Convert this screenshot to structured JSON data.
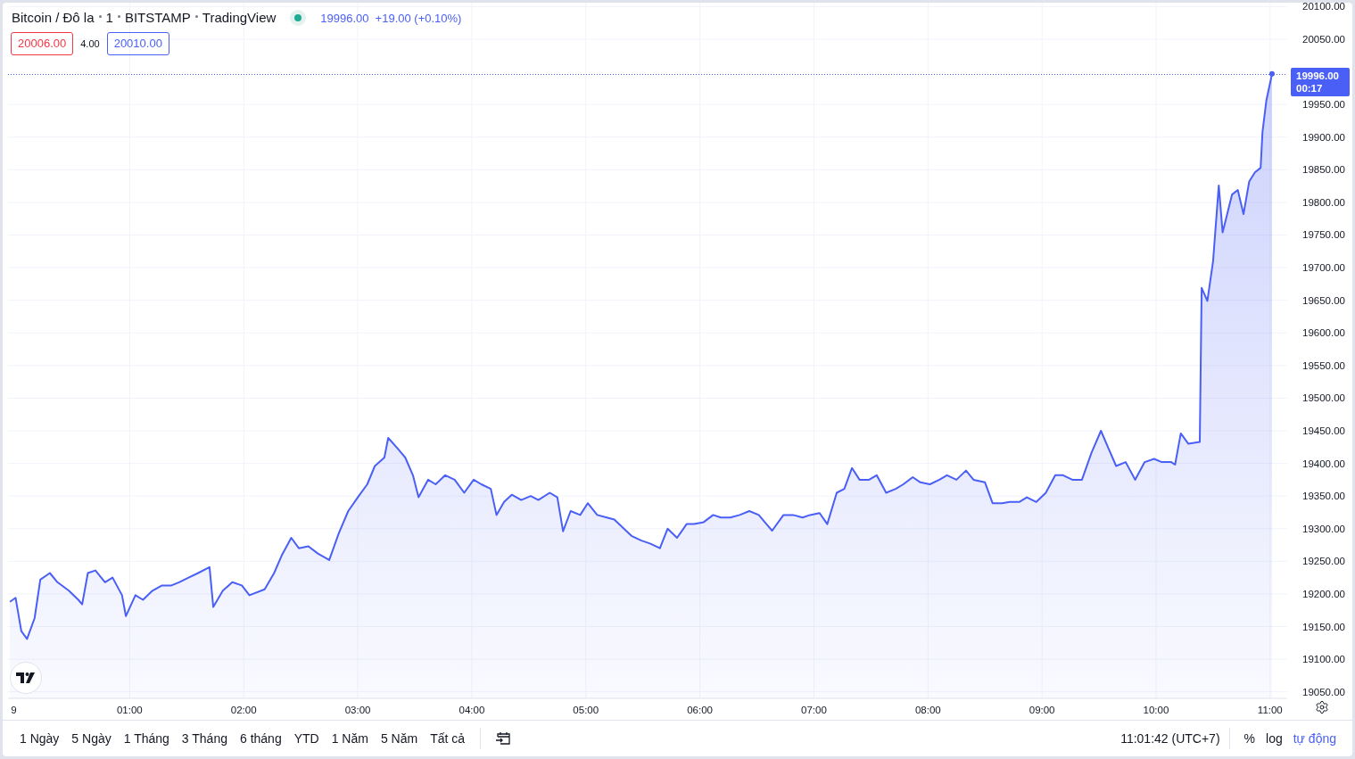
{
  "header": {
    "symbol": "Bitcoin / Đô la",
    "interval": "1",
    "exchange": "BITSTAMP",
    "source": "TradingView",
    "market_open": true,
    "price": "19996.00",
    "change": "+19.00 (+0.10%)"
  },
  "quote": {
    "bid": "20006.00",
    "spread": "4.00",
    "ask": "20010.00"
  },
  "chart": {
    "last_price": "19996.00",
    "countdown": "00:17",
    "day_label": "9",
    "chart_data": {
      "type": "area",
      "grid": true,
      "xlim": [
        -4,
        669
      ],
      "ylim": [
        19040,
        20106
      ],
      "ref_lines": [
        {
          "axis": "y",
          "value": 19996
        }
      ],
      "xticks": [
        {
          "value": 60,
          "label": "01:00"
        },
        {
          "value": 120,
          "label": "02:00"
        },
        {
          "value": 180,
          "label": "03:00"
        },
        {
          "value": 240,
          "label": "04:00"
        },
        {
          "value": 300,
          "label": "05:00"
        },
        {
          "value": 360,
          "label": "06:00"
        },
        {
          "value": 420,
          "label": "07:00"
        },
        {
          "value": 480,
          "label": "08:00"
        },
        {
          "value": 540,
          "label": "09:00"
        },
        {
          "value": 600,
          "label": "10:00"
        },
        {
          "value": 660,
          "label": "11:00"
        }
      ],
      "yticks": [
        {
          "value": 19050,
          "label": "19050.00"
        },
        {
          "value": 19100,
          "label": "19100.00"
        },
        {
          "value": 19150,
          "label": "19150.00"
        },
        {
          "value": 19200,
          "label": "19200.00"
        },
        {
          "value": 19250,
          "label": "19250.00"
        },
        {
          "value": 19300,
          "label": "19300.00"
        },
        {
          "value": 19350,
          "label": "19350.00"
        },
        {
          "value": 19400,
          "label": "19400.00"
        },
        {
          "value": 19450,
          "label": "19450.00"
        },
        {
          "value": 19500,
          "label": "19500.00"
        },
        {
          "value": 19550,
          "label": "19550.00"
        },
        {
          "value": 19600,
          "label": "19600.00"
        },
        {
          "value": 19650,
          "label": "19650.00"
        },
        {
          "value": 19700,
          "label": "19700.00"
        },
        {
          "value": 19750,
          "label": "19750.00"
        },
        {
          "value": 19800,
          "label": "19800.00"
        },
        {
          "value": 19850,
          "label": "19850.00"
        },
        {
          "value": 19900,
          "label": "19900.00"
        },
        {
          "value": 19950,
          "label": "19950.00"
        },
        {
          "value": 20050,
          "label": "20050.00"
        },
        {
          "value": 20100,
          "label": "20100.00"
        }
      ],
      "x": [
        -3,
        0,
        3,
        6,
        10,
        13,
        18,
        22,
        28,
        33,
        35,
        38,
        42,
        47,
        51,
        56,
        58,
        63,
        67,
        72,
        77,
        82,
        86,
        91,
        96,
        102,
        104,
        109,
        114,
        119,
        123,
        131,
        136,
        140,
        145,
        149,
        154,
        159,
        165,
        170,
        175,
        180,
        185,
        189,
        194,
        196,
        201,
        205,
        209,
        212,
        217,
        221,
        226,
        231,
        236,
        241,
        245,
        250,
        253,
        257,
        261,
        266,
        271,
        275,
        281,
        285,
        288,
        292,
        297,
        301,
        306,
        311,
        315,
        320,
        324,
        329,
        334,
        339,
        343,
        348,
        353,
        357,
        362,
        367,
        371,
        376,
        381,
        386,
        391,
        395,
        398,
        404,
        409,
        414,
        418,
        423,
        427,
        432,
        436,
        440,
        444,
        449,
        453,
        458,
        463,
        467,
        472,
        476,
        481,
        486,
        490,
        495,
        500,
        504,
        510,
        514,
        519,
        523,
        528,
        532,
        537,
        542,
        547,
        551,
        556,
        561,
        566,
        571,
        575,
        579,
        584,
        589,
        594,
        599,
        603,
        608,
        610,
        613,
        617,
        623,
        624,
        627,
        630,
        633,
        635,
        640,
        643,
        646,
        649,
        652,
        655,
        656,
        658,
        661
      ],
      "series": [
        {
          "color": "#4a5ff5",
          "values": [
            19188,
            19194,
            19143,
            19131,
            19163,
            19222,
            19232,
            19218,
            19205,
            19191,
            19184,
            19232,
            19236,
            19218,
            19225,
            19198,
            19166,
            19198,
            19191,
            19205,
            19213,
            19213,
            19218,
            19225,
            19232,
            19241,
            19180,
            19205,
            19218,
            19213,
            19198,
            19207,
            19232,
            19259,
            19286,
            19270,
            19273,
            19262,
            19252,
            19293,
            19327,
            19348,
            19368,
            19396,
            19409,
            19439,
            19423,
            19409,
            19382,
            19348,
            19375,
            19368,
            19382,
            19375,
            19355,
            19375,
            19368,
            19361,
            19321,
            19341,
            19352,
            19344,
            19350,
            19344,
            19355,
            19348,
            19296,
            19327,
            19321,
            19339,
            19321,
            19317,
            19314,
            19300,
            19289,
            19282,
            19277,
            19270,
            19300,
            19286,
            19307,
            19307,
            19310,
            19321,
            19317,
            19317,
            19321,
            19327,
            19321,
            19307,
            19297,
            19321,
            19321,
            19317,
            19321,
            19324,
            19307,
            19355,
            19361,
            19393,
            19375,
            19375,
            19382,
            19355,
            19361,
            19368,
            19379,
            19371,
            19368,
            19375,
            19382,
            19375,
            19389,
            19375,
            19371,
            19339,
            19339,
            19341,
            19341,
            19348,
            19341,
            19355,
            19382,
            19382,
            19375,
            19375,
            19416,
            19450,
            19423,
            19396,
            19402,
            19375,
            19402,
            19407,
            19402,
            19402,
            19398,
            19446,
            19430,
            19433,
            19669,
            19649,
            19710,
            19826,
            19754,
            19812,
            19819,
            19782,
            19832,
            19846,
            19853,
            19908,
            19956,
            19997
          ]
        }
      ]
    }
  },
  "range_buttons": [
    {
      "label": "1 Ngày"
    },
    {
      "label": "5 Ngày"
    },
    {
      "label": "1 Tháng"
    },
    {
      "label": "3 Tháng"
    },
    {
      "label": "6 tháng"
    },
    {
      "label": "YTD"
    },
    {
      "label": "1 Năm"
    },
    {
      "label": "5 Năm"
    },
    {
      "label": "Tất cả"
    }
  ],
  "status": {
    "time": "11:01:42 (UTC+7)",
    "toggles": [
      {
        "label": "%",
        "on": false
      },
      {
        "label": "log",
        "on": false
      },
      {
        "label": "tự động",
        "on": true
      }
    ]
  }
}
